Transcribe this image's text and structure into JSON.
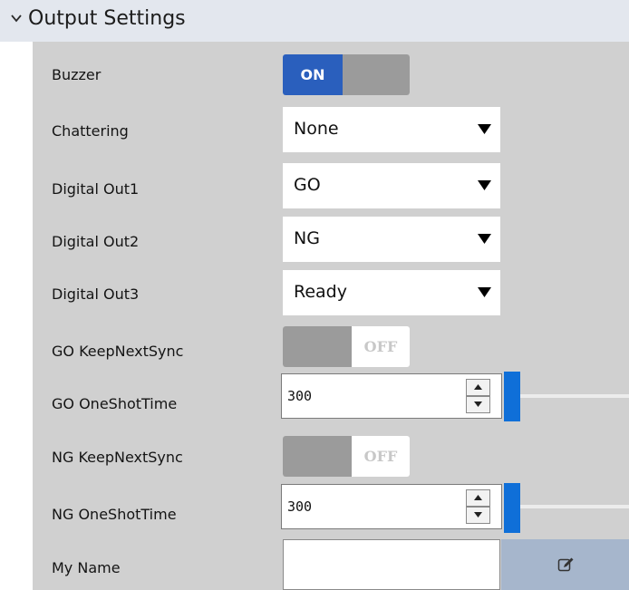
{
  "section": {
    "title": "Output Settings"
  },
  "settings": {
    "buzzer": {
      "label": "Buzzer",
      "state": "ON"
    },
    "chattering": {
      "label": "Chattering",
      "value": "None"
    },
    "digital_out1": {
      "label": "Digital Out1",
      "value": "GO"
    },
    "digital_out2": {
      "label": "Digital Out2",
      "value": "NG"
    },
    "digital_out3": {
      "label": "Digital Out3",
      "value": "Ready"
    },
    "go_keep_next_sync": {
      "label": "GO KeepNextSync",
      "state": "OFF"
    },
    "go_one_shot_time": {
      "label": "GO OneShotTime",
      "value": "300"
    },
    "ng_keep_next_sync": {
      "label": "NG KeepNextSync",
      "state": "OFF"
    },
    "ng_one_shot_time": {
      "label": "NG OneShotTime",
      "value": "300"
    },
    "my_name": {
      "label": "My Name",
      "value": ""
    }
  },
  "colors": {
    "toggle_on": "#2a5fbd",
    "toggle_off": "#9b9b9b",
    "slider_accent": "#0f6fd8",
    "panel_bg": "#d0d0d0",
    "header_bg": "#e3e7ee",
    "edit_button_bg": "#a6b6cc"
  },
  "icons": {
    "collapse": "chevron-down-icon",
    "dropdown": "triangle-down-icon",
    "spin_up": "triangle-up-icon",
    "spin_down": "triangle-down-icon",
    "edit": "edit-icon"
  }
}
